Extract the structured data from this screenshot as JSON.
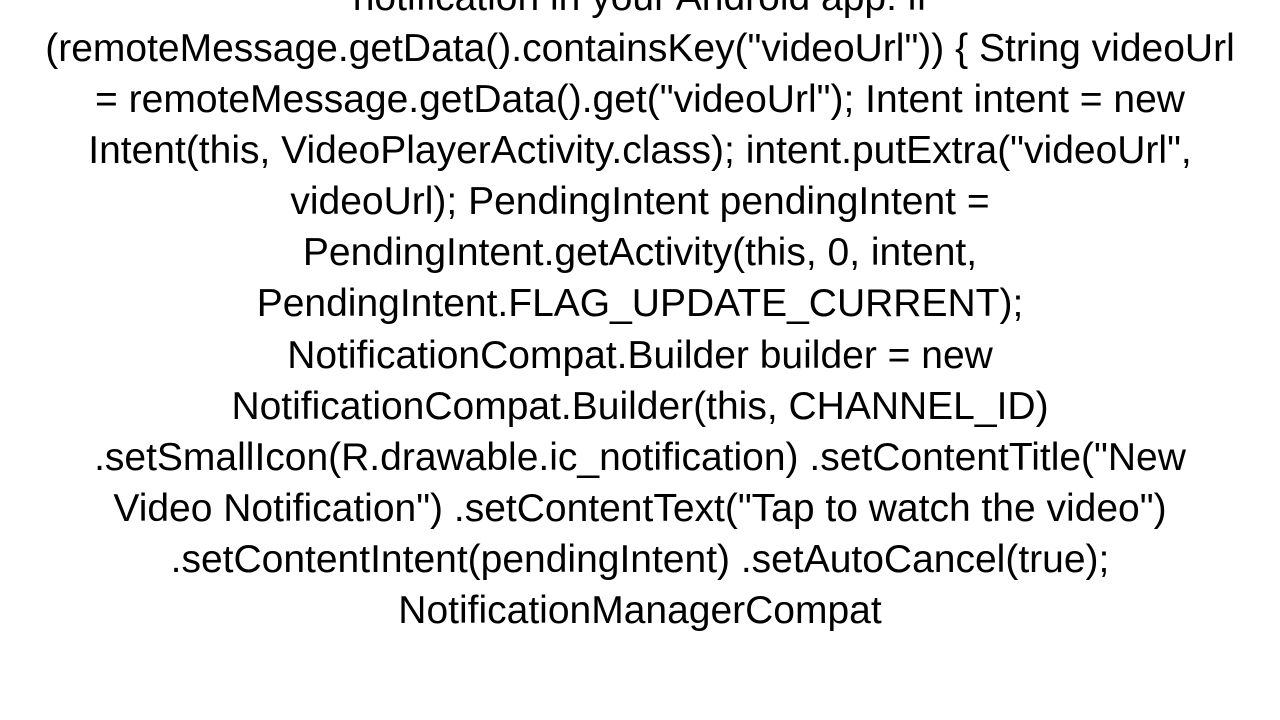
{
  "content": {
    "text": "notification in your Android app: if (remoteMessage.getData().containsKey(\"videoUrl\")) {     String videoUrl = remoteMessage.getData().get(\"videoUrl\");     Intent intent = new Intent(this, VideoPlayerActivity.class);     intent.putExtra(\"videoUrl\", videoUrl);     PendingIntent pendingIntent = PendingIntent.getActivity(this, 0, intent, PendingIntent.FLAG_UPDATE_CURRENT);      NotificationCompat.Builder builder = new NotificationCompat.Builder(this, CHANNEL_ID)             .setSmallIcon(R.drawable.ic_notification)             .setContentTitle(\"New Video Notification\")             .setContentText(\"Tap to watch the video\")             .setContentIntent(pendingIntent)             .setAutoCancel(true);      NotificationManagerCompat"
  }
}
